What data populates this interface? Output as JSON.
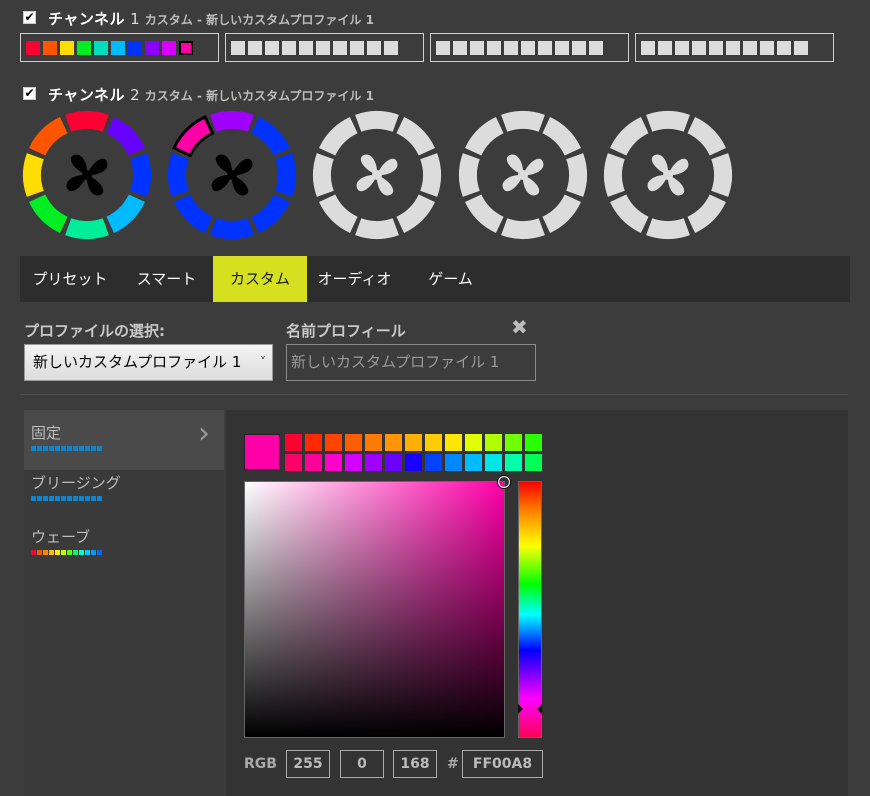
{
  "channel1": {
    "checked": "✔",
    "name": "チャンネル",
    "number": "1",
    "subtitle": "カスタム - 新しいカスタムプロファイル 1",
    "strips": [
      {
        "leds": [
          "#ff0033",
          "#ff5500",
          "#ffdd00",
          "#00ee22",
          "#00ddbb",
          "#00bbff",
          "#0033ff",
          "#8a00ff",
          "#d600ff",
          "#ff00a8"
        ],
        "selected": 9
      },
      {
        "leds": [
          "#dcdcdc",
          "#dcdcdc",
          "#dcdcdc",
          "#dcdcdc",
          "#dcdcdc",
          "#dcdcdc",
          "#dcdcdc",
          "#dcdcdc",
          "#dcdcdc",
          "#dcdcdc"
        ]
      },
      {
        "leds": [
          "#dcdcdc",
          "#dcdcdc",
          "#dcdcdc",
          "#dcdcdc",
          "#dcdcdc",
          "#dcdcdc",
          "#dcdcdc",
          "#dcdcdc",
          "#dcdcdc",
          "#dcdcdc"
        ]
      },
      {
        "leds": [
          "#dcdcdc",
          "#dcdcdc",
          "#dcdcdc",
          "#dcdcdc",
          "#dcdcdc",
          "#dcdcdc",
          "#dcdcdc",
          "#dcdcdc",
          "#dcdcdc",
          "#dcdcdc"
        ]
      }
    ]
  },
  "channel2": {
    "checked": "✔",
    "name": "チャンネル",
    "number": "2",
    "subtitle": "カスタム - 新しいカスタムプロファイル 1",
    "fans": [
      {
        "segments": [
          "#ff0033",
          "#6600ff",
          "#0033ff",
          "#00bbff",
          "#00ee99",
          "#00ee22",
          "#ffdd00",
          "#ff5500"
        ],
        "fan_color": "#000000",
        "selected": -1
      },
      {
        "segments": [
          "#a000ff",
          "#0033ff",
          "#0033ff",
          "#0033ff",
          "#0033ff",
          "#0033ff",
          "#0033ff",
          "#ff00a8"
        ],
        "fan_color": "#000000",
        "selected": 7
      },
      {
        "segments": [
          "#dcdcdc",
          "#dcdcdc",
          "#dcdcdc",
          "#dcdcdc",
          "#dcdcdc",
          "#dcdcdc",
          "#dcdcdc",
          "#dcdcdc"
        ],
        "fan_color": "#dcdcdc",
        "selected": -1
      },
      {
        "segments": [
          "#dcdcdc",
          "#dcdcdc",
          "#dcdcdc",
          "#dcdcdc",
          "#dcdcdc",
          "#dcdcdc",
          "#dcdcdc",
          "#dcdcdc"
        ],
        "fan_color": "#dcdcdc",
        "selected": -1
      },
      {
        "segments": [
          "#dcdcdc",
          "#dcdcdc",
          "#dcdcdc",
          "#dcdcdc",
          "#dcdcdc",
          "#dcdcdc",
          "#dcdcdc",
          "#dcdcdc"
        ],
        "fan_color": "#dcdcdc",
        "selected": -1
      }
    ]
  },
  "tabs": [
    {
      "label": "プリセット",
      "active": false
    },
    {
      "label": "スマート",
      "active": false
    },
    {
      "label": "カスタム",
      "active": true
    },
    {
      "label": "オーディオ",
      "active": false
    },
    {
      "label": "ゲーム",
      "active": false
    }
  ],
  "profile": {
    "select_label": "プロファイルの選択:",
    "selected_value": "新しいカスタムプロファイル 1",
    "chevron": "˅",
    "name_label": "名前プロフィール",
    "name_value": "新しいカスタムプロファイル 1",
    "delete_glyph": "✖"
  },
  "effects": [
    {
      "label": "固定",
      "active": true,
      "chevron": "›",
      "leds": [
        "#0a86d6",
        "#0a86d6",
        "#0a86d6",
        "#0a86d6",
        "#0a86d6",
        "#0a86d6",
        "#0a86d6",
        "#0a86d6",
        "#0a86d6",
        "#0a86d6",
        "#0a86d6",
        "#0a86d6"
      ]
    },
    {
      "label": "ブリージング",
      "active": false,
      "leds": [
        "#0a86d6",
        "#0a86d6",
        "#0a86d6",
        "#0a86d6",
        "#0a86d6",
        "#0a86d6",
        "#0a86d6",
        "#0a86d6",
        "#0a86d6",
        "#0a86d6",
        "#0a86d6",
        "#0a86d6"
      ]
    },
    {
      "label": "ウェーブ",
      "active": false,
      "leds": [
        "#ff0033",
        "#ff5500",
        "#ff8800",
        "#ffbb00",
        "#ffee00",
        "#bbff00",
        "#55ff00",
        "#00ff66",
        "#00ffcc",
        "#00ccff",
        "#0099ff",
        "#0066ff"
      ]
    }
  ],
  "picker": {
    "current_color": "#ff00a8",
    "swatches_row1": [
      "#ff0033",
      "#ff2a00",
      "#ff4400",
      "#ff5e00",
      "#ff7a00",
      "#ff9500",
      "#ffb000",
      "#ffcc00",
      "#ffe600",
      "#e0ff00",
      "#b0ff00",
      "#70ff00",
      "#2aff00"
    ],
    "swatches_row2": [
      "#ff0066",
      "#ff0099",
      "#ff00cc",
      "#d400ff",
      "#a000ff",
      "#6a00ff",
      "#1a00ff",
      "#0044ff",
      "#0088ff",
      "#00bbff",
      "#00e6e6",
      "#00ffaa",
      "#00ff55"
    ],
    "rgb_label": "RGB",
    "r": "255",
    "g": "0",
    "b": "168",
    "hash": "#",
    "hex": "FF00A8"
  }
}
